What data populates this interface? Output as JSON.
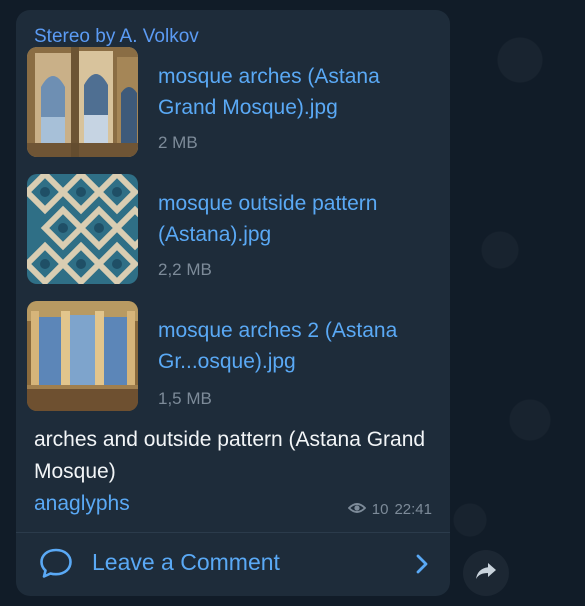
{
  "post": {
    "author": "Stereo by A. Volkov",
    "files": [
      {
        "name": "mosque arches (Astana Grand Mosque).jpg",
        "size": "2 MB"
      },
      {
        "name": "mosque outside pattern (Astana).jpg",
        "size": "2,2 MB"
      },
      {
        "name": "mosque arches 2 (Astana Gr...osque).jpg",
        "size": "1,5 MB"
      }
    ],
    "caption": "arches and outside pattern (Astana Grand Mosque)",
    "hashtag": "anaglyphs",
    "views": "10",
    "time": "22:41",
    "comment_label": "Leave a Comment"
  },
  "icons": {
    "views": "eye-icon",
    "comment": "chat-bubble-icon",
    "chevron": "chevron-right-icon",
    "share": "share-arrow-icon"
  },
  "colors": {
    "accent": "#5aa9f5",
    "author": "#5b9bf4",
    "bubble": "#1e2c3a",
    "background": "#0e1621",
    "muted": "#7d8b99"
  }
}
